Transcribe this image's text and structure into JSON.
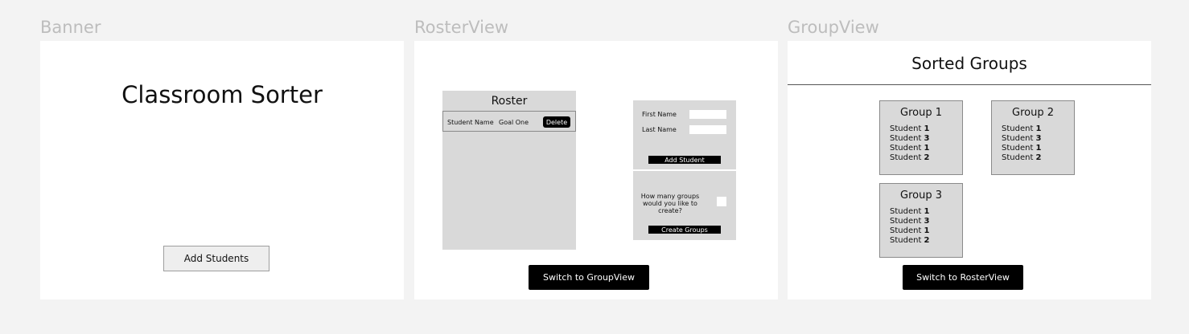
{
  "frames": {
    "banner": {
      "label": "Banner",
      "title": "Classroom Sorter",
      "add_students_label": "Add Students"
    },
    "roster_view": {
      "label": "RosterView",
      "roster_title": "Roster",
      "roster_rows": [
        {
          "student": "Student Name",
          "goal": "Goal One",
          "delete_label": "Delete"
        }
      ],
      "first_name_label": "First Name",
      "first_name_value": "",
      "last_name_label": "Last Name",
      "last_name_value": "",
      "add_student_label": "Add Student",
      "groups_question": "How many groups would you like to create?",
      "groups_count_value": "",
      "create_groups_label": "Create Groups",
      "switch_label": "Switch to GroupView"
    },
    "group_view": {
      "label": "GroupView",
      "header": "Sorted Groups",
      "groups": [
        {
          "title": "Group 1",
          "members": [
            {
              "prefix": "Student ",
              "num": "1"
            },
            {
              "prefix": "Student ",
              "num": "3"
            },
            {
              "prefix": "Student ",
              "num": "1"
            },
            {
              "prefix": "Student ",
              "num": "2"
            }
          ]
        },
        {
          "title": "Group 2",
          "members": [
            {
              "prefix": "Student ",
              "num": "1"
            },
            {
              "prefix": "Student ",
              "num": "3"
            },
            {
              "prefix": "Student ",
              "num": "1"
            },
            {
              "prefix": "Student ",
              "num": "2"
            }
          ]
        },
        {
          "title": "Group 3",
          "members": [
            {
              "prefix": "Student ",
              "num": "1"
            },
            {
              "prefix": "Student ",
              "num": "3"
            },
            {
              "prefix": "Student ",
              "num": "1"
            },
            {
              "prefix": "Student ",
              "num": "2"
            }
          ]
        }
      ],
      "switch_label": "Switch to RosterView"
    }
  },
  "colors": {
    "canvas": "#f3f3f3",
    "frame": "#ffffff",
    "panel": "#d9d9d9",
    "primary_button": "#000000",
    "label_gray": "#bdbdbd"
  }
}
